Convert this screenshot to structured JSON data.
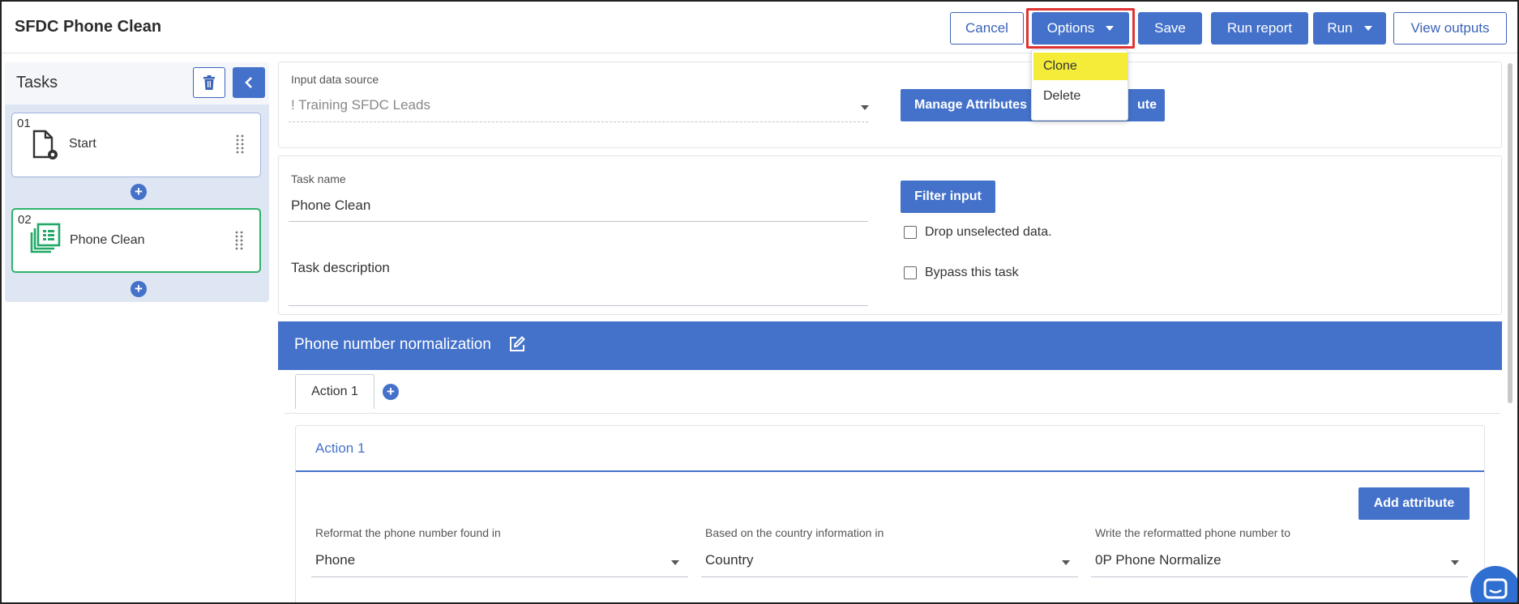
{
  "header": {
    "title": "SFDC Phone Clean",
    "buttons": {
      "cancel": "Cancel",
      "options": "Options",
      "save": "Save",
      "run_report": "Run report",
      "run": "Run",
      "view_outputs": "View outputs"
    }
  },
  "options_menu": {
    "items": [
      "Clone",
      "Delete"
    ],
    "highlighted": "Clone"
  },
  "tasks": {
    "title": "Tasks",
    "items": [
      {
        "num": "01",
        "label": "Start",
        "icon": "document-gear-icon"
      },
      {
        "num": "02",
        "label": "Phone Clean",
        "icon": "table-stack-icon"
      }
    ]
  },
  "input_source": {
    "label": "Input data source",
    "value": "! Training SFDC Leads",
    "manage_button": "Manage Attributes",
    "hidden_button_tail": "ute"
  },
  "task_config": {
    "name_label": "Task name",
    "name_value": "Phone Clean",
    "description_label": "Task description",
    "filter_button": "Filter input",
    "drop_unselected": "Drop unselected data.",
    "bypass": "Bypass this task"
  },
  "normalization": {
    "title": "Phone number normalization",
    "tab": "Action 1",
    "action_title": "Action 1",
    "add_attribute": "Add attribute",
    "fields": [
      {
        "label": "Reformat the phone number found in",
        "value": "Phone"
      },
      {
        "label": "Based on the country information in",
        "value": "Country"
      },
      {
        "label": "Write the reformatted phone number to",
        "value": "0P Phone Normalize"
      }
    ]
  },
  "colors": {
    "primary": "#4472ca",
    "active_task_border": "#2db36a",
    "menu_highlight": "#f5ec3a",
    "annotation_red": "#e03434"
  }
}
